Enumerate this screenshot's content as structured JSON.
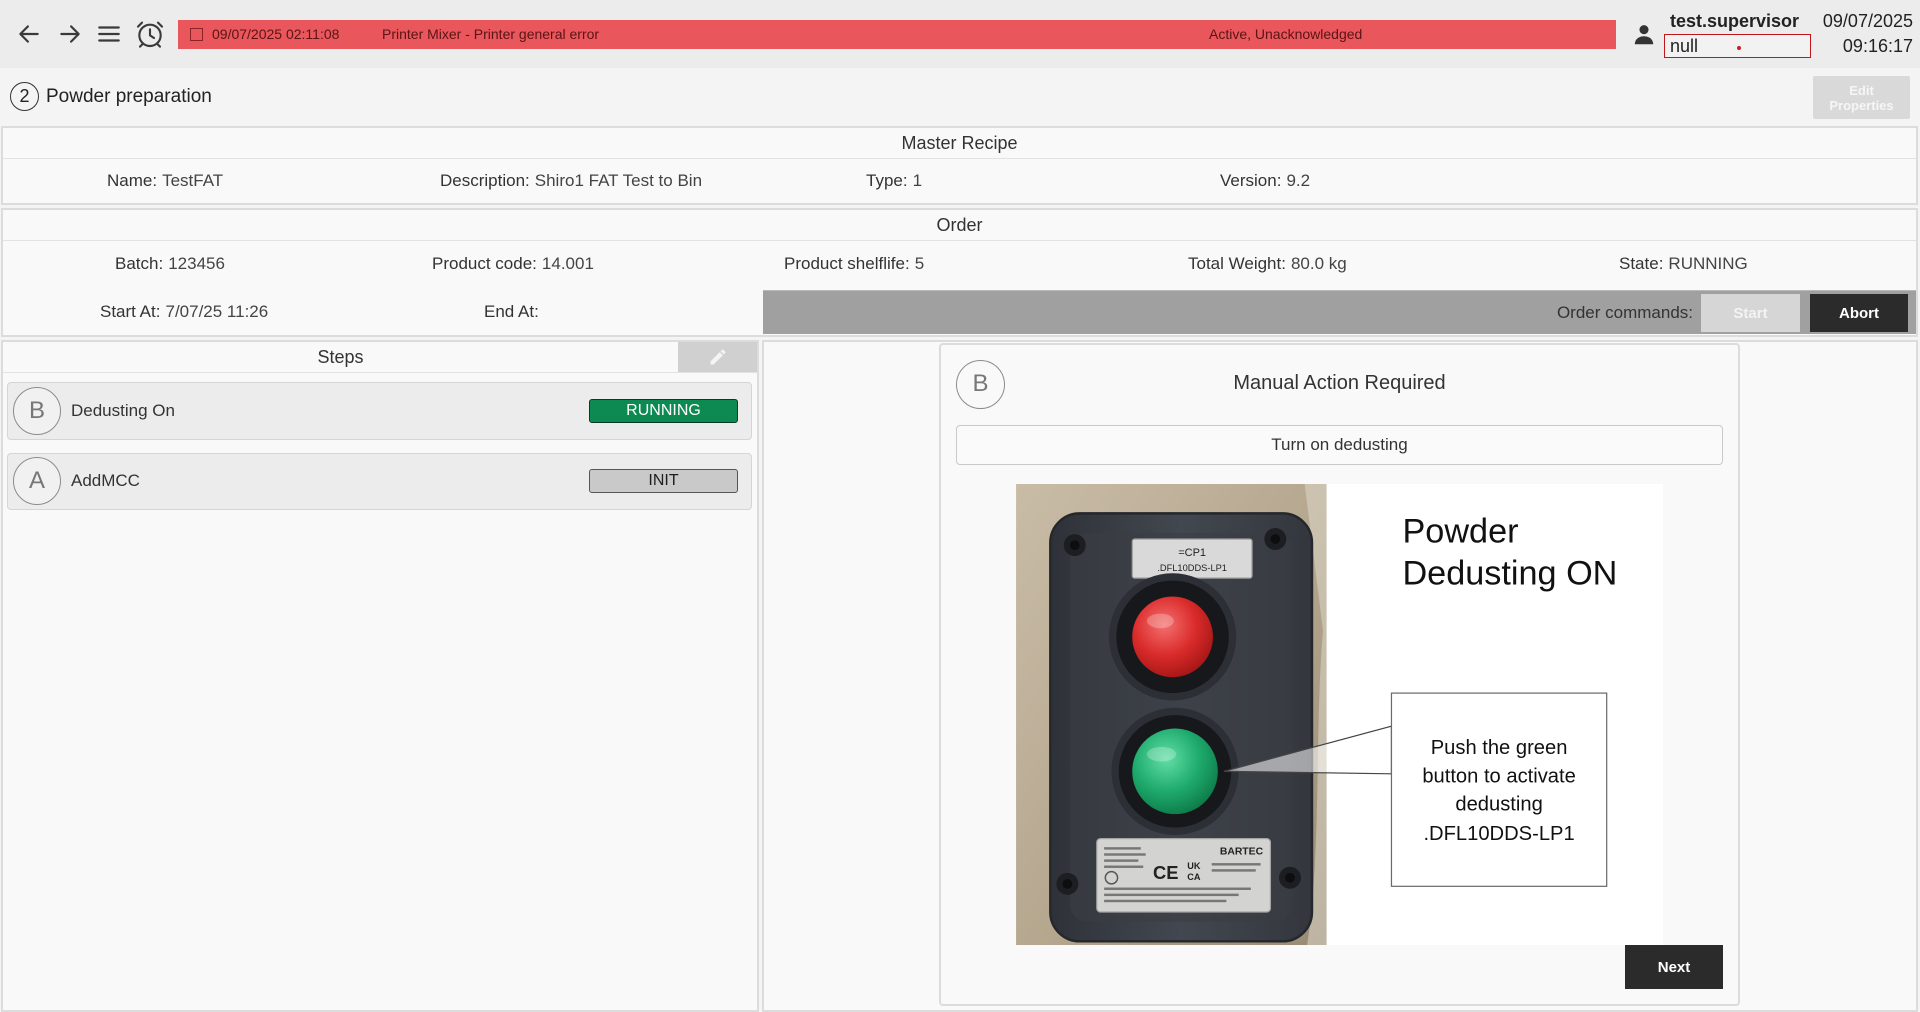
{
  "colors": {
    "alarm_bg": "#e9565b",
    "alarm_text": "#5b1416",
    "command_bar": "#a0a0a0",
    "abort_bg": "#2b2b2b",
    "next_bg": "#2b2b2b",
    "disabled_bg": "#d9d9d9",
    "null_border": "#c1161c"
  },
  "topbar": {
    "back_icon": "arrow-left-icon",
    "forward_icon": "arrow-right-icon",
    "menu_icon": "hamburger-menu-icon",
    "alarm_icon": "alarm-clock-icon",
    "alarm": {
      "timestamp": "09/07/2025 02:11:08",
      "message": "Printer Mixer - Printer general error",
      "status": "Active, Unacknowledged"
    },
    "user": {
      "icon": "user-icon",
      "name": "test.supervisor",
      "field_value": "null"
    },
    "clock": {
      "date": "09/07/2025",
      "time": "09:16:17"
    }
  },
  "page": {
    "step_number": "2",
    "title": "Powder preparation",
    "edit_properties_label": "Edit Properties"
  },
  "master_recipe": {
    "heading": "Master Recipe",
    "fields": [
      {
        "label": "Name:",
        "value": "TestFAT"
      },
      {
        "label": "Description:",
        "value": "Shiro1 FAT Test to Bin"
      },
      {
        "label": "Type:",
        "value": "1"
      },
      {
        "label": "Version:",
        "value": "9.2"
      }
    ]
  },
  "order": {
    "heading": "Order",
    "fields": [
      {
        "label": "Batch:",
        "value": "123456"
      },
      {
        "label": "Product code:",
        "value": "14.001"
      },
      {
        "label": "Product shelflife:",
        "value": "5"
      },
      {
        "label": "Total Weight:",
        "value": "80.0 kg"
      },
      {
        "label": "State:",
        "value": "RUNNING"
      },
      {
        "label": "Start At:",
        "value": "7/07/25 11:26"
      },
      {
        "label": "End At:"
      }
    ],
    "commands": {
      "label": "Order commands:",
      "start": "Start",
      "abort": "Abort"
    }
  },
  "steps": {
    "heading": "Steps",
    "edit_icon": "pencil-icon",
    "items": [
      {
        "letter": "B",
        "name": "Dedusting On",
        "status": "RUNNING",
        "status_bg": "#0d8a52",
        "status_fg": "#ffffff"
      },
      {
        "letter": "A",
        "name": "AddMCC",
        "status": "INIT",
        "status_bg": "#c9c9c9",
        "status_fg": "#1e1e1e"
      }
    ]
  },
  "manual_action": {
    "step_letter": "B",
    "title": "Manual Action Required",
    "instruction": "Turn on dedusting",
    "image": {
      "heading_lines": [
        "Powder",
        "Dedusting ON"
      ],
      "callout_lines": [
        "Push the green",
        "button to activate",
        "dedusting",
        ".DFL10DDS-LP1"
      ],
      "device_tag_lines": [
        "=CP1",
        ".DFL10DDS-LP1"
      ],
      "device_brand": "BARTEC",
      "device_marks": [
        "CE",
        "UK",
        "CA"
      ]
    },
    "next_label": "Next"
  }
}
